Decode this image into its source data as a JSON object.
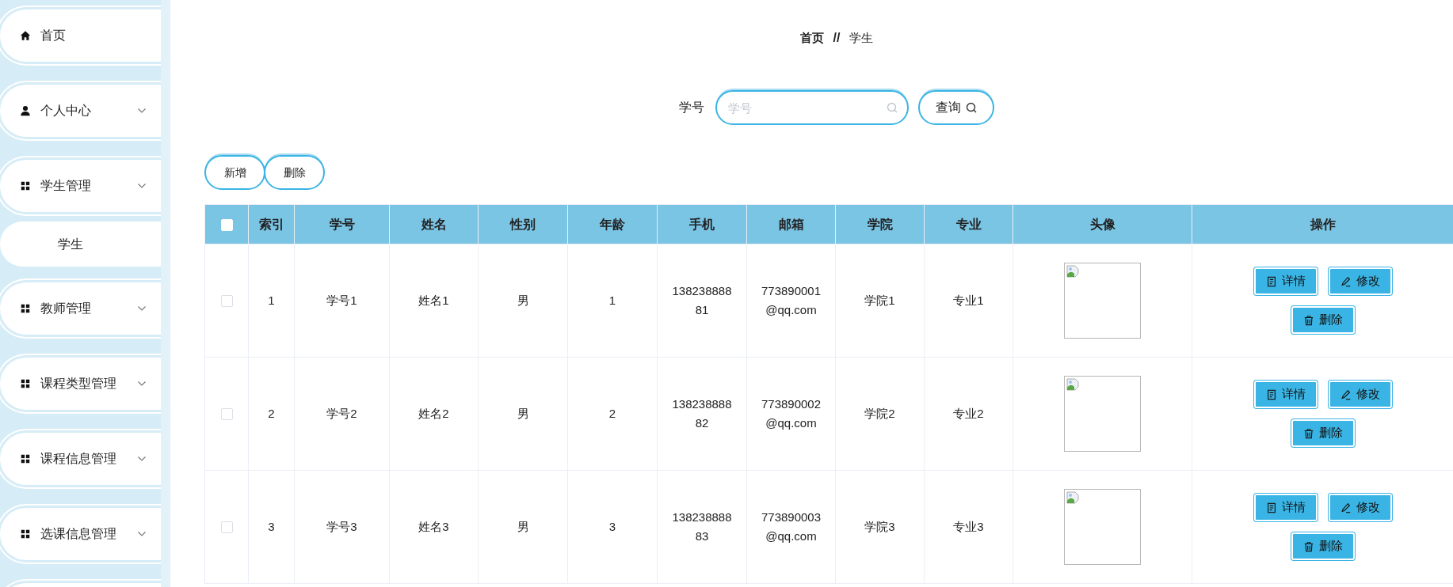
{
  "sidebar": {
    "items": [
      {
        "kind": "home",
        "label": "首页",
        "expandable": false
      },
      {
        "kind": "user",
        "label": "个人中心",
        "expandable": true
      },
      {
        "kind": "grid",
        "label": "学生管理",
        "expandable": true,
        "children": [
          {
            "label": "学生"
          }
        ]
      },
      {
        "kind": "grid",
        "label": "教师管理",
        "expandable": true
      },
      {
        "kind": "grid",
        "label": "课程类型管理",
        "expandable": true
      },
      {
        "kind": "grid",
        "label": "课程信息管理",
        "expandable": true
      },
      {
        "kind": "grid",
        "label": "选课信息管理",
        "expandable": true
      }
    ]
  },
  "breadcrumb": {
    "items": [
      "首页",
      "学生"
    ],
    "separator": "//"
  },
  "search": {
    "label": "学号",
    "placeholder": "学号",
    "button": "查询"
  },
  "toolbar": [
    "新增",
    "删除"
  ],
  "table": {
    "select_all_checked": false,
    "columns": [
      "索引",
      "学号",
      "姓名",
      "性别",
      "年龄",
      "手机",
      "邮箱",
      "学院",
      "专业",
      "头像",
      "操作"
    ],
    "rows": [
      {
        "checked": false,
        "cells": [
          "1",
          "学号1",
          "姓名1",
          "男",
          "1",
          "13823888881",
          "773890001@qq.com",
          "学院1",
          "专业1"
        ],
        "actions": [
          {
            "kind": "detail",
            "label": "详情"
          },
          {
            "kind": "edit",
            "label": "修改"
          },
          {
            "kind": "delete",
            "label": "删除"
          }
        ]
      },
      {
        "checked": false,
        "cells": [
          "2",
          "学号2",
          "姓名2",
          "男",
          "2",
          "13823888882",
          "773890002@qq.com",
          "学院2",
          "专业2"
        ],
        "actions": [
          {
            "kind": "detail",
            "label": "详情"
          },
          {
            "kind": "edit",
            "label": "修改"
          },
          {
            "kind": "delete",
            "label": "删除"
          }
        ]
      },
      {
        "checked": false,
        "cells": [
          "3",
          "学号3",
          "姓名3",
          "男",
          "3",
          "13823888883",
          "773890003@qq.com",
          "学院3",
          "专业3"
        ],
        "actions": [
          {
            "kind": "detail",
            "label": "详情"
          },
          {
            "kind": "edit",
            "label": "修改"
          },
          {
            "kind": "delete",
            "label": "删除"
          }
        ]
      }
    ]
  }
}
